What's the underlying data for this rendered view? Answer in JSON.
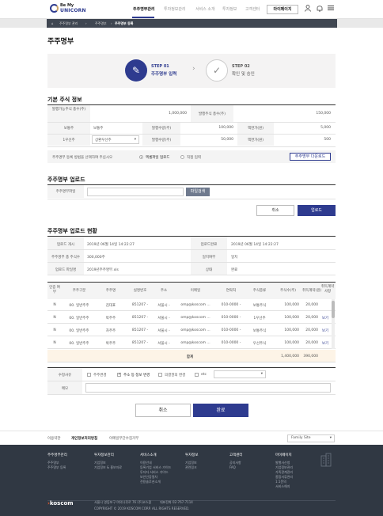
{
  "header": {
    "logo_line1": "Be My",
    "logo_line2": "UNICORN",
    "nav": [
      "주주명부관리",
      "투자정보관리",
      "서비스 소개",
      "투자정보",
      "고객센터"
    ],
    "mypage": "마이페이지"
  },
  "breadcrumb": [
    "주주명부 관리",
    "주주명부",
    "주주명부 등록"
  ],
  "page_title": "주주명부",
  "steps": [
    {
      "no": "STEP 01",
      "name": "주주명부 입력",
      "icon": "edit-icon",
      "state": "active"
    },
    {
      "no": "STEP 02",
      "name": "확인 및 승인",
      "icon": "check-icon",
      "state": "inactive"
    }
  ],
  "basic": {
    "title": "기본 주식 정보",
    "issuable_label": "발행가능주식 총수(주)",
    "issuable_value": "1,000,000",
    "issued_label": "발행주식 총수(주)",
    "issued_value": "150,000",
    "r2": {
      "l1": "보통주",
      "v1": "보통주",
      "l2": "발행수량(주)",
      "v2": "100,000",
      "l3": "액면가(원)",
      "v3": "5,000"
    },
    "r3": {
      "l1": "1우선주",
      "v1": "상환우선주",
      "l2": "발행수량(주)",
      "v2": "50,000",
      "l3": "액면가(원)",
      "v3": "500"
    },
    "method_q": "주주명부 등록 방법을 선택하여 주십시오",
    "method_opt1": "엑셀파일 업로드",
    "method_opt2": "직접 입력",
    "download_btn": "주주명부 다운로드"
  },
  "upload": {
    "title": "주주명부 업로드",
    "file_label": "주주명부파일",
    "file_value": "",
    "find_btn": "파일검색",
    "cancel_btn": "취소",
    "upload_btn": "업로드"
  },
  "status": {
    "title": "주주명부 업로드 현황",
    "rows": [
      {
        "l1": "업로드 개시",
        "v1": "2019년 06월 14일 14:22:27",
        "l2": "업로드완료",
        "v2": "2019년 06월 14일 14:22:27"
      },
      {
        "l1": "주주명부 총 주식수",
        "v1": "300,000주",
        "l2": "일치여부",
        "v2": "일치"
      },
      {
        "l1": "업로드 파일명",
        "v1": "2019년주주명부.xls",
        "l2": "상태",
        "v2": "완료"
      }
    ]
  },
  "table": {
    "headers": [
      "인증 여부",
      "주주구분",
      "주주명",
      "실명번호",
      "주소",
      "이메일",
      "연락처",
      "주식종류",
      "주식수(주)",
      "취득계약(원)",
      "취득계약 사항"
    ],
    "rows": [
      [
        "N",
        "00. 일반주주",
        "김대표",
        "851207 -",
        "서울시 -",
        "omp@koscom ...",
        "010-0000 -",
        "보통주식",
        "100,000",
        "20,000",
        ""
      ],
      [
        "N",
        "00. 일반주주",
        "박주주",
        "851207 -",
        "서울시 -",
        "omp@koscom ...",
        "010-0000 -",
        "1우선주",
        "100,000",
        "20,000",
        "보기"
      ],
      [
        "N",
        "00. 일반주주",
        "차주주",
        "851207 -",
        "서울시 -",
        "omp@koscom ...",
        "010-0000 -",
        "보통주식",
        "100,000",
        "20,000",
        "보기"
      ],
      [
        "N",
        "00. 일반주주",
        "박주주",
        "851207 -",
        "서울시 -",
        "omp@koscom ...",
        "010-0000 -",
        "우선주식",
        "100,000",
        "20,000",
        "보기"
      ]
    ],
    "sum_label": "합계",
    "sum_shares": "1,400,000",
    "sum_price": "390,000"
  },
  "reason": {
    "label": "수정사유",
    "options": [
      {
        "label": "주주변경",
        "checked": false
      },
      {
        "label": "주소 등 정보 변경",
        "checked": true
      },
      {
        "label": "의결권의 변경",
        "checked": false
      },
      {
        "label": "etc",
        "checked": false
      }
    ],
    "note_label": "메모"
  },
  "bottom": {
    "cancel": "취소",
    "complete": "완료"
  },
  "footer": {
    "links": [
      "이용약관",
      "개인정보처리방침",
      "이메일무단수집거부"
    ],
    "family_site": "Family Site",
    "cols": [
      {
        "title": "주주명부관리",
        "items": [
          "주주명부",
          "주주명부 등록"
        ]
      },
      {
        "title": "투자정보관리",
        "items": [
          "기업정보",
          "기업정보 & 홍보자료"
        ]
      },
      {
        "title": "서비스소개",
        "items": [
          "이용안내",
          "등록기업 서비스 가이드",
          "투자자 서비스 가이드",
          "보안인증절차",
          "전용솔루션소개"
        ]
      },
      {
        "title": "투자정보",
        "items": [
          "기업정보",
          "관련링크"
        ]
      },
      {
        "title": "고객센터",
        "items": [
          "공지사항",
          "FAQ"
        ]
      },
      {
        "title": "마이페이지",
        "items": [
          "발행사신청",
          "기업정보관리",
          "가족관계관리",
          "종합서류관리",
          "1:1문의",
          "서비스해지"
        ]
      }
    ],
    "logo": "koscom",
    "address": "서울시 영등포구 여의나루로 76 (주)코스콤",
    "tel": "대표전화 02-767-7114",
    "copyright": "COPYRIGHT © 2019 KOSCOM CORP. ALL RIGHTS RESERVED."
  },
  "colors": {
    "primary": "#2e3b8f",
    "footer_bg": "#303843",
    "accent": "#c9a46a"
  }
}
